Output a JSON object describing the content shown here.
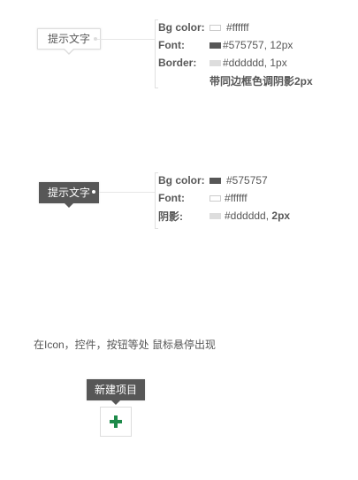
{
  "colors": {
    "white": "#ffffff",
    "dark": "#575757",
    "border": "#dddddd",
    "plus_green": "#1e8a4a"
  },
  "tooltip_light": {
    "label": "提示文字",
    "specs": [
      {
        "key": "Bg color:",
        "swatch": "#ffffff",
        "value": "#ffffff"
      },
      {
        "key": "Font:",
        "swatch": "#575757",
        "value": "#575757, 12px"
      },
      {
        "key": "Border:",
        "swatch": "#dddddd",
        "value": "#dddddd, 1px"
      }
    ],
    "note": "带同边框色调阴影2px"
  },
  "tooltip_dark": {
    "label": "提示文字",
    "specs": [
      {
        "key": "Bg color:",
        "swatch": "#575757",
        "value": "#575757"
      },
      {
        "key": "Font:",
        "swatch": "#ffffff",
        "value": "#ffffff"
      },
      {
        "key": "阴影:",
        "swatch": "#dddddd",
        "value": "#dddddd,",
        "value_bold": "2px"
      }
    ]
  },
  "usage_note": "在Icon，控件，按钮等处 鼠标悬停出现",
  "example": {
    "tooltip_label": "新建项目",
    "button_icon": "plus-icon"
  }
}
